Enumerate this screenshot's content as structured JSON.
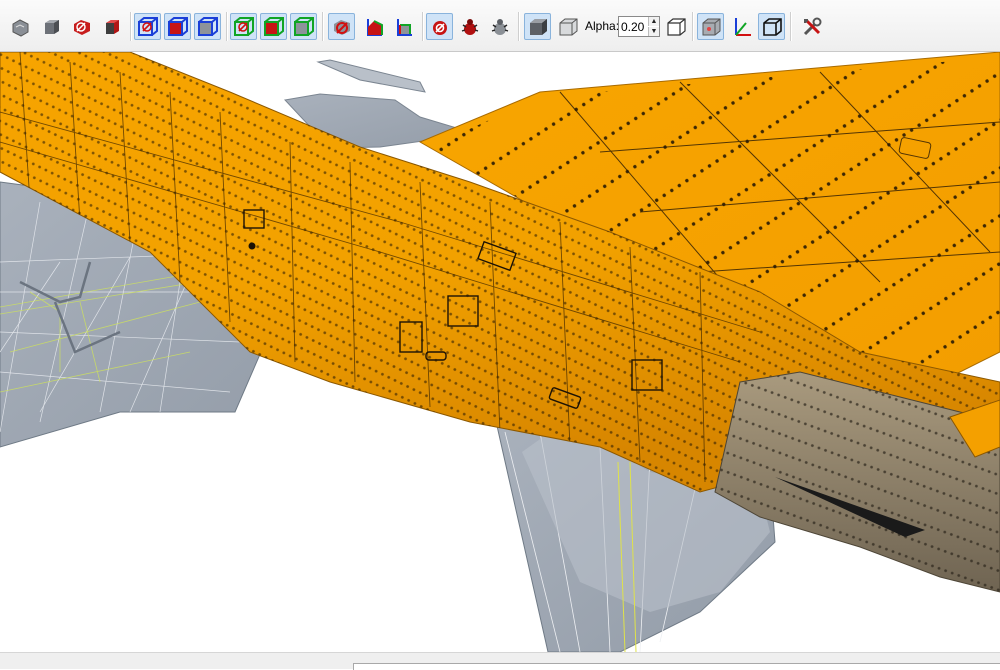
{
  "toolbar": {
    "buttons": [
      {
        "name": "view-solid-gray-icon",
        "active": false
      },
      {
        "name": "view-shaded-cube-icon",
        "active": false
      },
      {
        "name": "view-red-points-icon",
        "active": false
      },
      {
        "name": "view-red-cube-icon",
        "active": false
      },
      {
        "name": "wireframe-blue-points-icon",
        "active": true
      },
      {
        "name": "wireframe-blue-solid-icon",
        "active": true
      },
      {
        "name": "wireframe-blue-box-icon",
        "active": true
      },
      {
        "name": "wireframe-green-points-icon",
        "active": true
      },
      {
        "name": "wireframe-green-solid-icon",
        "active": true
      },
      {
        "name": "wireframe-green-box-icon",
        "active": true
      },
      {
        "name": "select-points-icon",
        "active": true
      },
      {
        "name": "select-faces-color-icon",
        "active": false
      },
      {
        "name": "select-faces-outline-icon",
        "active": false
      },
      {
        "name": "highlight-target-icon",
        "active": true
      },
      {
        "name": "bug-red-icon",
        "active": false
      },
      {
        "name": "bug-gray-icon",
        "active": false
      },
      {
        "name": "solid-shading-icon",
        "active": true
      },
      {
        "name": "transparent-shading-icon",
        "active": false
      },
      {
        "name": "transparent-box-icon",
        "active": false
      },
      {
        "name": "gray-cube-view-icon",
        "active": true
      },
      {
        "name": "axes-icon",
        "active": false
      },
      {
        "name": "wire-cube-icon",
        "active": true
      },
      {
        "name": "tools-settings-icon",
        "active": false
      }
    ],
    "alpha_label": "Alpha:",
    "alpha_value": "0.20",
    "spin_up": "▲",
    "spin_down": "▼"
  },
  "colors": {
    "fuselage_orange": "#f5a000",
    "fuselage_shadow": "#d98a00",
    "wing_gray": "#a5aeb9",
    "nozzle_tan": "#8a7d66",
    "toolbar_active": "#cfe3f7"
  },
  "statusbar": {
    "text": ""
  }
}
